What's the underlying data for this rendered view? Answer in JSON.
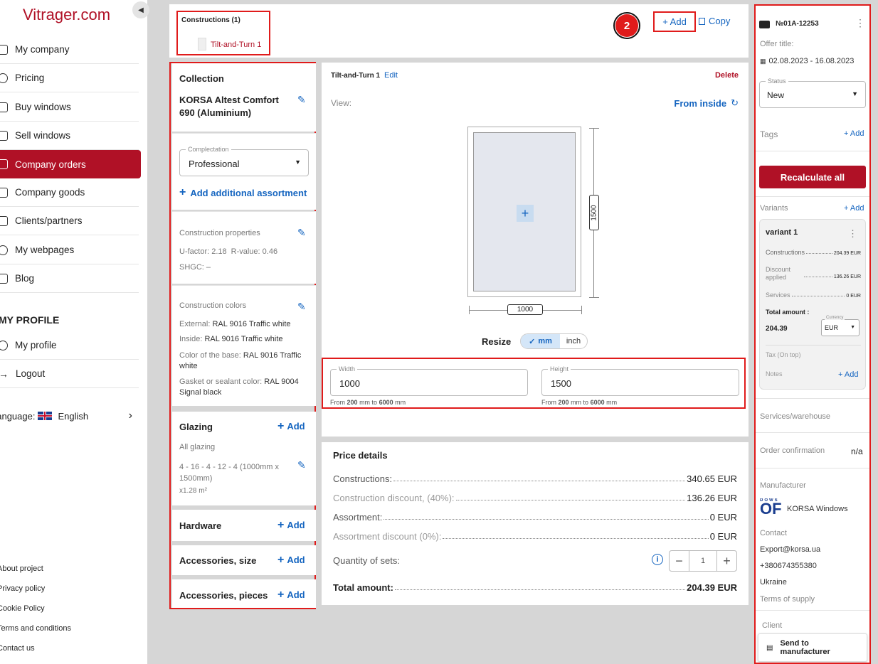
{
  "sidebar": {
    "logo": "Vitrager.com",
    "items": [
      {
        "label": "My company"
      },
      {
        "label": "Pricing"
      },
      {
        "label": "Buy windows"
      },
      {
        "label": "Sell windows"
      },
      {
        "label": "Company orders"
      },
      {
        "label": "Company goods"
      },
      {
        "label": "Clients/partners"
      },
      {
        "label": "My webpages"
      },
      {
        "label": "Blog"
      }
    ],
    "profile_section": "MY PROFILE",
    "profile_items": [
      {
        "label": "My profile"
      },
      {
        "label": "Logout"
      }
    ],
    "language_label": "Language:",
    "language_value": "English",
    "footer_links": [
      "About project",
      "Privacy policy",
      "Cookie Policy",
      "Terms and conditions",
      "Contact us"
    ]
  },
  "topbar": {
    "constructions_title": "Constructions (1)",
    "construction_item": "Tilt-and-Turn 1",
    "step_badge": "2",
    "add_label": "+ Add",
    "copy_label": "Copy"
  },
  "collection": {
    "title": "Collection",
    "name": "KORSA Altest Comfort 690 (Aluminium)",
    "complectation_label": "Complectation",
    "complectation_value": "Professional",
    "add_assortment": "Add additional assortment"
  },
  "construction_properties": {
    "title": "Construction properties",
    "ufactor": "U-factor: 2.18",
    "rvalue": "R-value: 0.46",
    "shgc": "SHGC: –"
  },
  "construction_colors": {
    "title": "Construction colors",
    "external_label": "External:",
    "external_value": "RAL 9016 Traffic white",
    "inside_label": "Inside:",
    "inside_value": "RAL 9016 Traffic white",
    "base_label": "Color of the base:",
    "base_value": "RAL 9016 Traffic white",
    "gasket_label": "Gasket or sealant color:",
    "gasket_value": "RAL 9004 Signal black"
  },
  "glazing": {
    "title": "Glazing",
    "add": "Add",
    "all": "All glazing",
    "spec": "4 - 16 - 4 - 12 - 4 (1000mm x 1500mm)",
    "area": "x1.28 m²"
  },
  "hardware": {
    "title": "Hardware",
    "add": "Add"
  },
  "accessories_size": {
    "title": "Accessories, size",
    "add": "Add"
  },
  "accessories_pieces": {
    "title": "Accessories, pieces",
    "add": "Add"
  },
  "editor": {
    "name": "Tilt-and-Turn 1",
    "edit": "Edit",
    "delete": "Delete",
    "view_label": "View:",
    "view_value": "From inside",
    "dim_height": "1500",
    "dim_width": "1000",
    "resize_label": "Resize",
    "unit_mm": "mm",
    "unit_inch": "inch",
    "width_label": "Width",
    "width_value": "1000",
    "height_label": "Height",
    "height_value": "1500",
    "range_prefix": "From",
    "range_min": "200",
    "range_mid": "mm to",
    "range_max": "6000",
    "range_unit": "mm"
  },
  "price": {
    "title": "Price details",
    "rows": [
      {
        "label": "Constructions:",
        "value": "340.65 EUR"
      },
      {
        "label": "Construction discount, (40%):",
        "value": "136.26 EUR"
      },
      {
        "label": "Assortment:",
        "value": "0 EUR"
      },
      {
        "label": "Assortment discount (0%):",
        "value": "0 EUR"
      }
    ],
    "quantity_label": "Quantity of sets:",
    "quantity_value": "1",
    "total_label": "Total amount:",
    "total_value": "204.39 EUR"
  },
  "right": {
    "order_no": "№01A-12253",
    "offer_title": "Offer title:",
    "dates": "02.08.2023 - 16.08.2023",
    "status_label": "Status",
    "status_value": "New",
    "tags": "Tags",
    "add": "+ Add",
    "recalc": "Recalculate all",
    "variants": "Variants",
    "variant_name": "variant 1",
    "v_constructions_label": "Constructions",
    "v_constructions_value": "204.39 EUR",
    "v_discount_label_1": "Discount",
    "v_discount_label_2": "applied",
    "v_discount_value": "136.26 EUR",
    "v_services_label": "Services",
    "v_services_value": "0 EUR",
    "v_total_label": "Total amount :",
    "v_total_value": "204.39",
    "currency_label": "Currency",
    "currency_value": "EUR",
    "tax": "Tax (On top)",
    "notes": "Notes",
    "services_warehouse": "Services/warehouse",
    "order_confirmation": "Order confirmation",
    "order_confirmation_value": "n/a",
    "manufacturer": "Manufacturer",
    "manufacturer_name": "KORSA Windows",
    "contact": "Contact",
    "email": "Export@korsa.ua",
    "phone": "+380674355380",
    "country": "Ukraine",
    "terms": "Terms of supply",
    "client": "Client",
    "send": "Send to manufacturer"
  },
  "colors": {
    "brand": "#b01126",
    "accent": "#1565c0",
    "highlight": "#e01b1b"
  }
}
